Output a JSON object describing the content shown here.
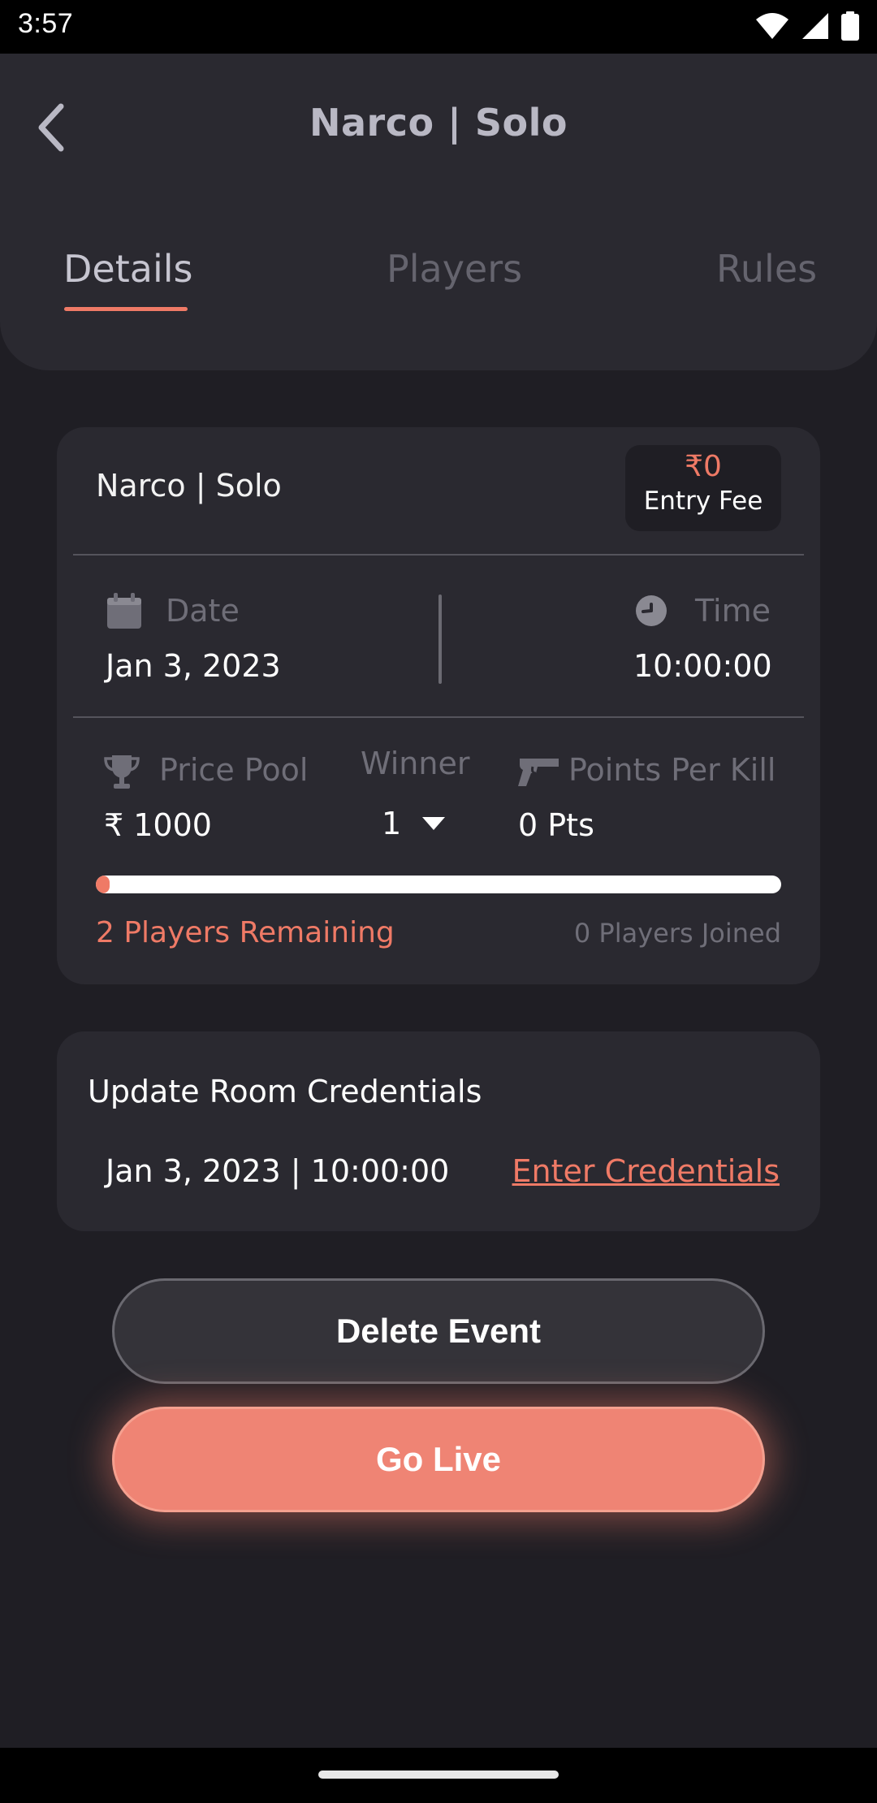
{
  "status_bar": {
    "time": "3:57",
    "icons": [
      "wifi-icon",
      "signal-icon",
      "battery-icon"
    ]
  },
  "header": {
    "title": "Narco | Solo",
    "back_icon": "chevron-left-icon",
    "tabs": [
      {
        "label": "Details",
        "active": true
      },
      {
        "label": "Players",
        "active": false
      },
      {
        "label": "Rules",
        "active": false
      }
    ]
  },
  "event_card": {
    "name": "Narco  |  Solo",
    "fee_amount": "₹0",
    "fee_label": "Entry Fee",
    "date_label": "Date",
    "date_value": "Jan 3, 2023",
    "time_label": "Time",
    "time_value": "10:00:00",
    "prize_label": "Price Pool",
    "prize_value": "₹ 1000",
    "winner_label": "Winner",
    "winner_value": "1",
    "ppk_label": "Points Per Kill",
    "ppk_value": "0 Pts",
    "progress_fraction": 0.02,
    "remaining_text": "2 Players Remaining",
    "joined_text": "0 Players Joined"
  },
  "credentials_card": {
    "title": "Update Room Credentials",
    "datetime": "Jan 3, 2023  |  10:00:00",
    "link_label": "Enter Credentials"
  },
  "actions": {
    "delete_label": "Delete Event",
    "live_label": "Go Live"
  },
  "colors": {
    "accent": "#ef7a66",
    "background": "#1f1e24",
    "card": "#2a2930"
  }
}
